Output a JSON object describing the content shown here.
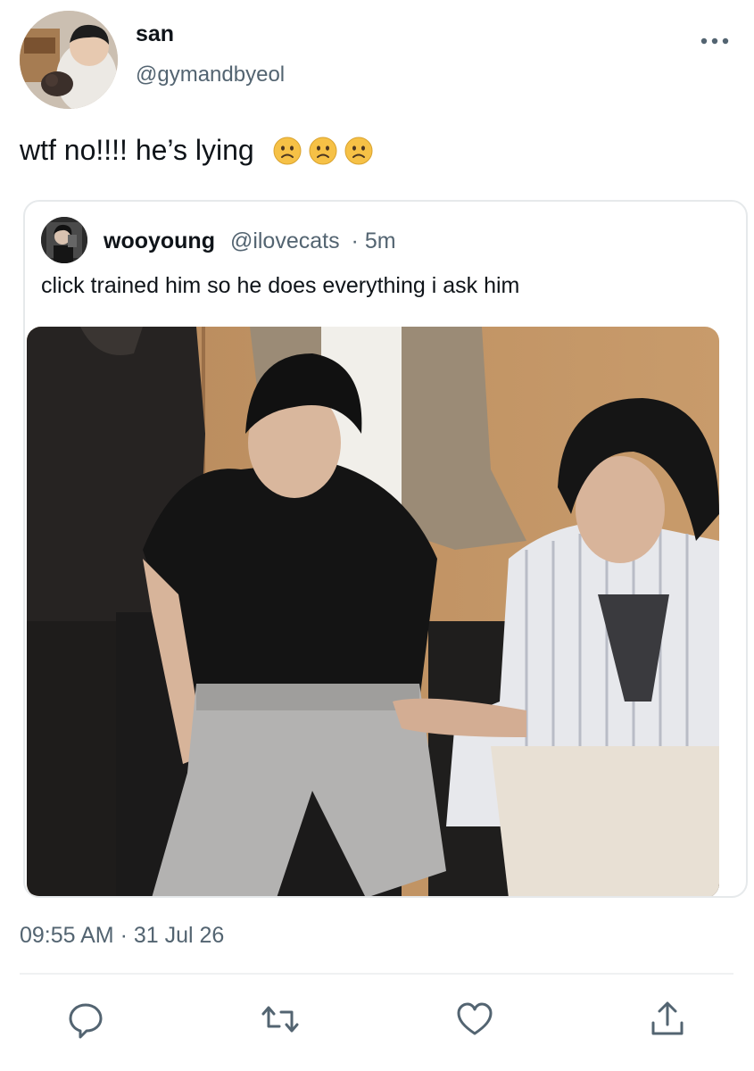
{
  "tweet": {
    "display_name": "san",
    "handle": "@gymandbyeol",
    "text": "wtf no!!!! he’s lying",
    "emojis": [
      "slightly-frowning-face-icon",
      "slightly-frowning-face-icon",
      "slightly-frowning-face-icon"
    ],
    "timestamp": "09:55 AM · 31 Jul 26"
  },
  "quote": {
    "display_name": "wooyoung",
    "handle": "@ilovecats",
    "age": "· 5m",
    "text": "click trained him so he does everything i ask him",
    "photo": "photo of two people seated on chairs in front of a wooden wall"
  },
  "actions": {
    "icons": [
      "reply-icon",
      "retweet-icon",
      "like-icon",
      "share-icon"
    ]
  },
  "colors": {
    "text_primary": "#0f1419",
    "text_secondary": "#536471",
    "border": "#e6e9eb",
    "icon": "#536471",
    "emoji": "#f6c146"
  }
}
